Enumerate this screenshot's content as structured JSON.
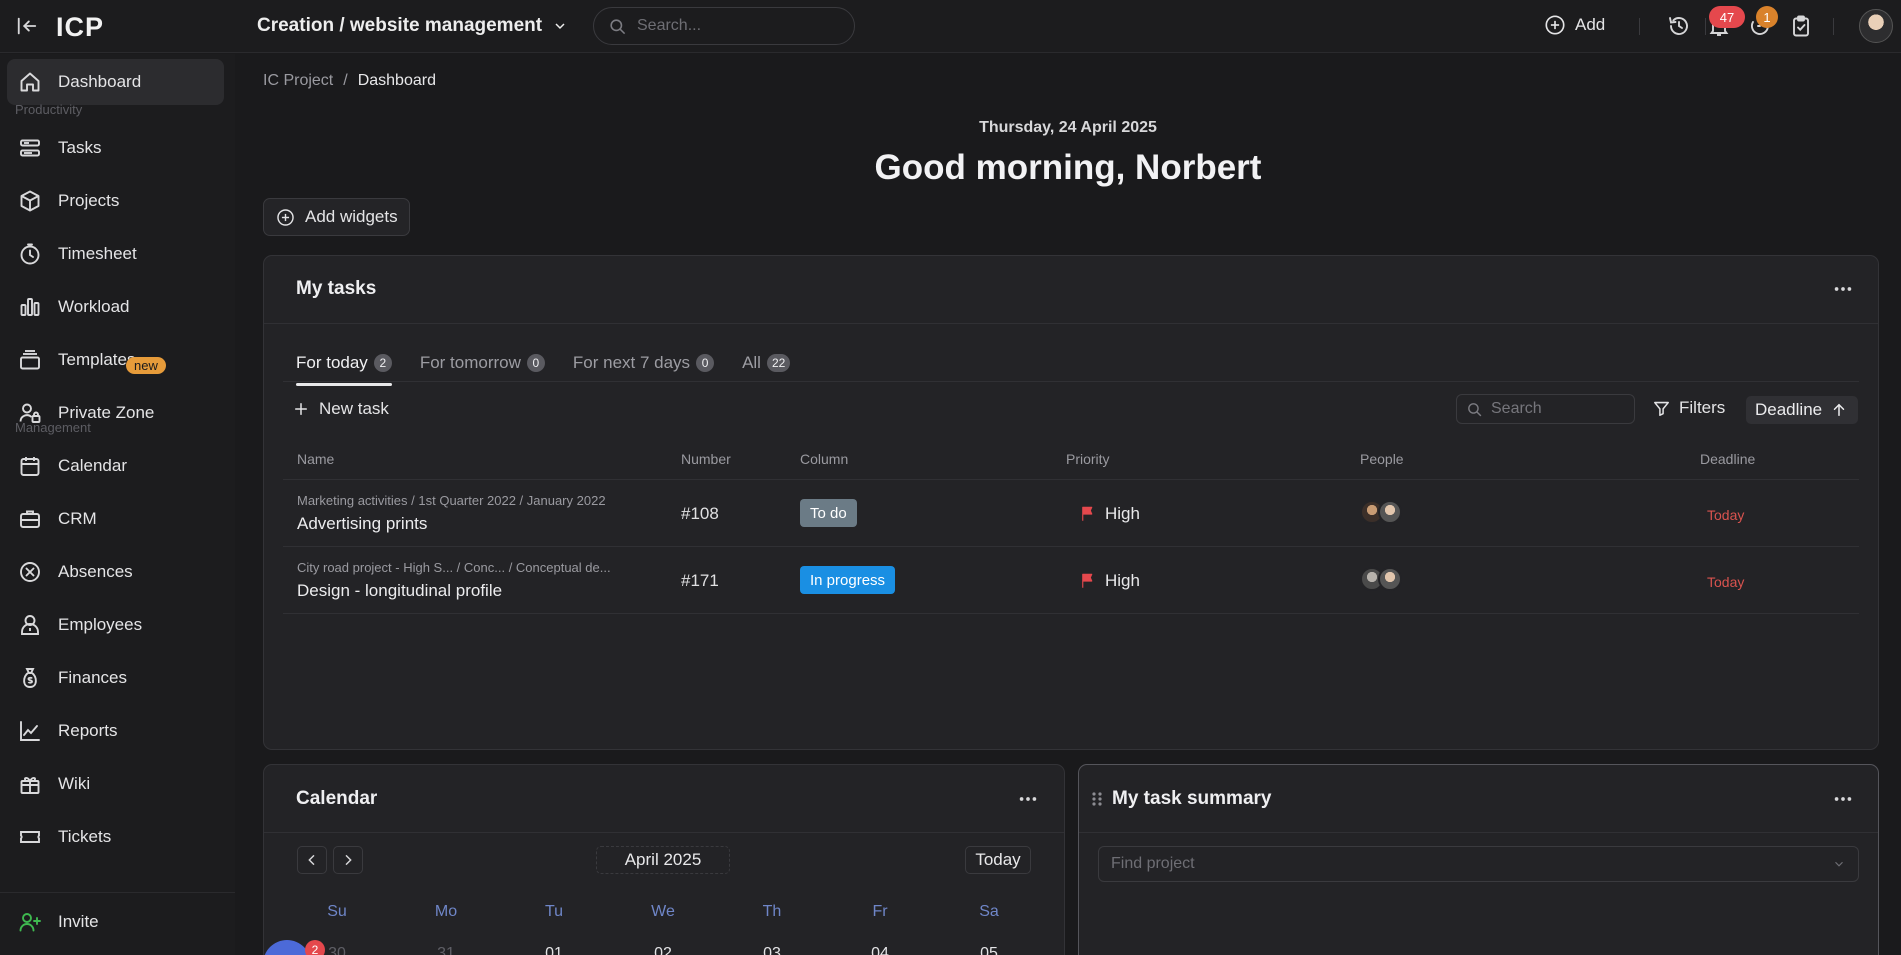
{
  "topbar": {
    "logo": "ICP",
    "project_title": "Creation / website management",
    "search_placeholder": "Search...",
    "add_label": "Add",
    "notifications_count": "47",
    "timer_count": "1"
  },
  "sidebar": {
    "items": [
      {
        "label": "Dashboard"
      },
      {
        "label": "Tasks"
      },
      {
        "label": "Projects"
      },
      {
        "label": "Timesheet"
      },
      {
        "label": "Workload"
      },
      {
        "label": "Templates"
      },
      {
        "label": "Private Zone"
      },
      {
        "label": "Calendar"
      },
      {
        "label": "CRM"
      },
      {
        "label": "Absences"
      },
      {
        "label": "Employees"
      },
      {
        "label": "Finances"
      },
      {
        "label": "Reports"
      },
      {
        "label": "Wiki"
      },
      {
        "label": "Tickets"
      }
    ],
    "section_productivity": "Productivity",
    "section_management": "Management",
    "new_badge": "new",
    "invite_label": "Invite"
  },
  "breadcrumb": {
    "root": "IC Project",
    "separator": "/",
    "current": "Dashboard"
  },
  "greeting": {
    "date": "Thursday, 24 April 2025",
    "text": "Good morning, Norbert"
  },
  "add_widgets_label": "Add widgets",
  "my_tasks": {
    "title": "My tasks",
    "tabs": [
      {
        "label": "For today",
        "count": "2"
      },
      {
        "label": "For tomorrow",
        "count": "0"
      },
      {
        "label": "For next 7 days",
        "count": "0"
      },
      {
        "label": "All",
        "count": "22"
      }
    ],
    "new_task_label": "New task",
    "search_placeholder": "Search",
    "filters_label": "Filters",
    "sort_label": "Deadline",
    "columns": [
      "Name",
      "Number",
      "Column",
      "Priority",
      "People",
      "Deadline"
    ],
    "rows": [
      {
        "path": "Marketing activities / 1st Quarter 2022 / January 2022",
        "name": "Advertising prints",
        "number": "#108",
        "column": "To do",
        "column_color": "#6b7b86",
        "priority": "High",
        "deadline": "Today"
      },
      {
        "path": "City road project - High S...  / Conc...  / Conceptual de...",
        "name": "Design - longitudinal profile",
        "number": "#171",
        "column": "In progress",
        "column_color": "#1a8fe3",
        "priority": "High",
        "deadline": "Today"
      }
    ]
  },
  "calendar": {
    "title": "Calendar",
    "month": "April 2025",
    "today_label": "Today",
    "weekdays": [
      "Su",
      "Mo",
      "Tu",
      "We",
      "Th",
      "Fr",
      "Sa"
    ],
    "first_row": [
      "30",
      "31",
      "01",
      "02",
      "03",
      "04",
      "05"
    ],
    "event_count": "2"
  },
  "task_summary": {
    "title": "My task summary",
    "find_placeholder": "Find project"
  },
  "colors": {
    "accent_blue": "#1a8fe3",
    "priority_red": "#e5484d",
    "deadline_red": "#d9534f",
    "new_badge": "#e69b3a"
  }
}
